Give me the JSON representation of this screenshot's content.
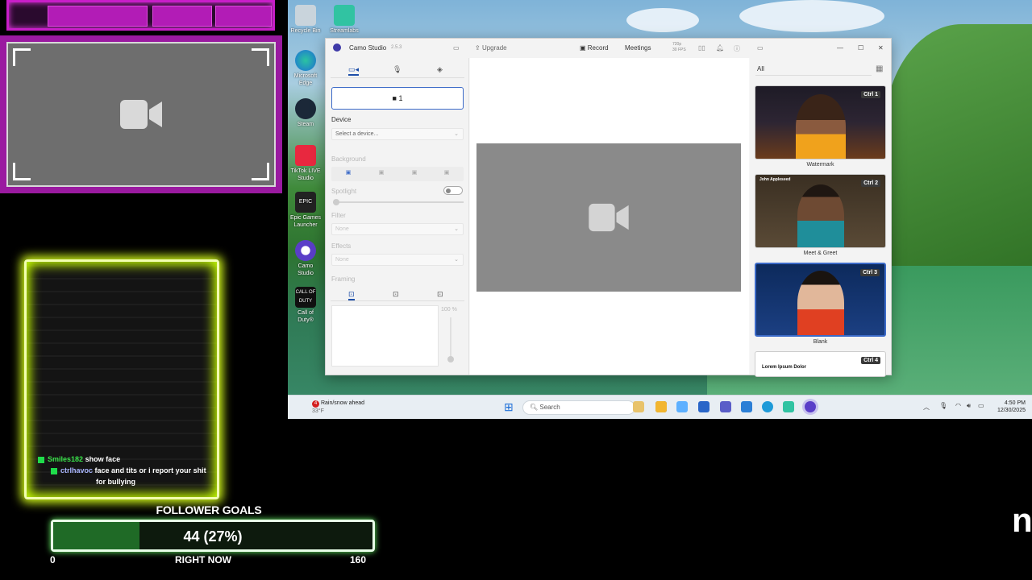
{
  "overlay": {
    "chat": [
      {
        "user": "Smiles182",
        "message": "show face"
      },
      {
        "user": "ctrlhavoc",
        "message": "face and tits or i report your shit"
      },
      {
        "user": "",
        "message": "for bullying"
      }
    ],
    "follower_goals": {
      "title": "FOLLOWER GOALS",
      "value_text": "44 (27%)",
      "progress_fraction": 0.27,
      "min": "0",
      "now_label": "RIGHT NOW",
      "max": "160"
    },
    "corner_letter": "n"
  },
  "desktop": {
    "icons": [
      {
        "label": "Recycle Bin",
        "icon": "recycle-bin-icon"
      },
      {
        "label": "Microsoft Edge",
        "icon": "edge-icon"
      },
      {
        "label": "Steam",
        "icon": "steam-icon"
      },
      {
        "label": "TikTok LIVE Studio",
        "icon": "tiktok-icon"
      },
      {
        "label": "Epic Games Launcher",
        "icon": "epic-games-icon"
      },
      {
        "label": "Camo Studio",
        "icon": "camo-icon"
      },
      {
        "label": "Call of Duty®",
        "icon": "call-of-duty-icon"
      },
      {
        "label": "Streamlabs",
        "icon": "streamlabs-icon"
      }
    ]
  },
  "camo": {
    "title": "Camo Studio",
    "version": "2.5.3",
    "upgrade": "Upgrade",
    "record": "Record",
    "meetings": "Meetings",
    "res": "720p",
    "fps": "30 FPS",
    "camera_button": "1",
    "device_label": "Device",
    "device_placeholder": "Select a device...",
    "background_label": "Background",
    "spotlight_label": "Spotlight",
    "filter_label": "Filter",
    "filter_value": "None",
    "effects_label": "Effects",
    "effects_value": "None",
    "framing_label": "Framing",
    "zoom": "100 %",
    "scenes_filter": "All",
    "scenes": [
      {
        "name": "Watermark",
        "shortcut": "Ctrl",
        "num": "1"
      },
      {
        "name": "Meet & Greet",
        "shortcut": "Ctrl",
        "num": "2",
        "overlay_name": "John Appleseed"
      },
      {
        "name": "Blank",
        "shortcut": "Ctrl",
        "num": "3"
      },
      {
        "name": "",
        "shortcut": "Ctrl",
        "num": "4",
        "overlay_name": "Lorem Ipsum Dolor"
      }
    ]
  },
  "taskbar": {
    "weather_alert": "4",
    "weather": "Rain/snow ahead",
    "temp": "33°F",
    "search": "Search",
    "time": "4:50 PM",
    "date": "12/30/2025"
  }
}
